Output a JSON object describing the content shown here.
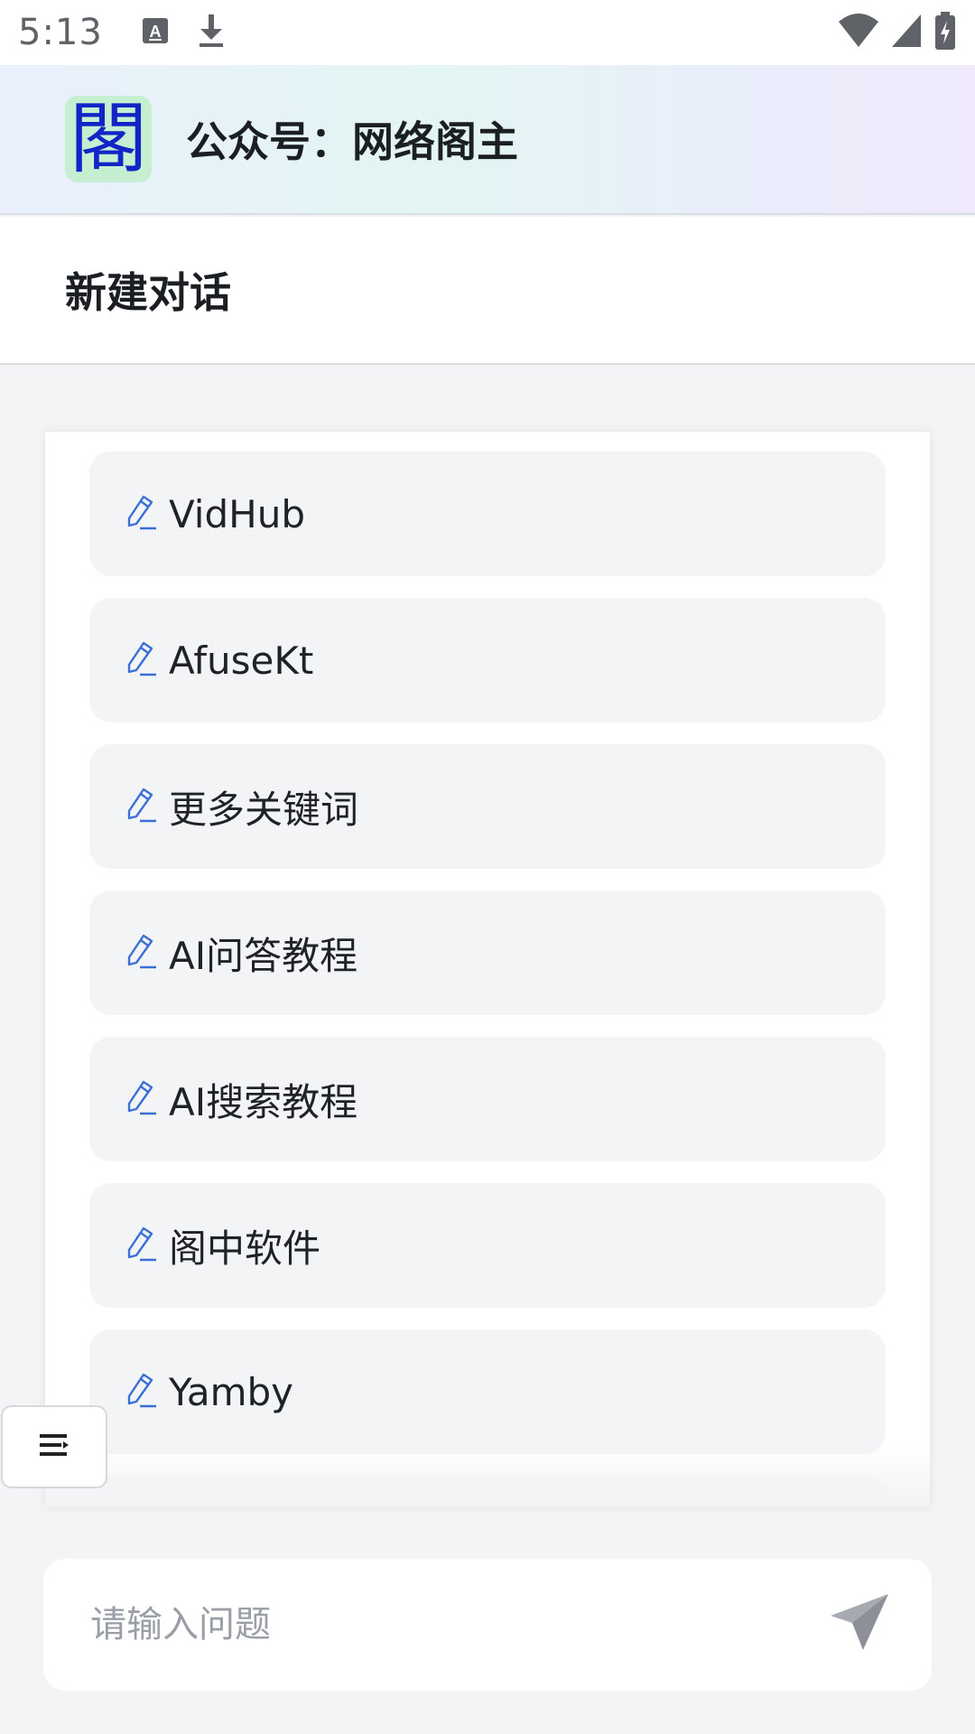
{
  "status_bar": {
    "time": "5:13",
    "icons": [
      "font-download-icon",
      "download-icon",
      "wifi-icon",
      "signal-icon",
      "battery-charging-icon"
    ]
  },
  "header": {
    "logo_char": "閣",
    "title": "公众号：网络阁主"
  },
  "new_chat": {
    "label": "新建对话"
  },
  "suggestions": [
    {
      "label": "VidHub",
      "icon": "pencil-icon"
    },
    {
      "label": "AfuseKt",
      "icon": "pencil-icon"
    },
    {
      "label": "更多关键词",
      "icon": "pencil-icon"
    },
    {
      "label": "AI问答教程",
      "icon": "pencil-icon"
    },
    {
      "label": "AI搜索教程",
      "icon": "pencil-icon"
    },
    {
      "label": "阁中软件",
      "icon": "pencil-icon"
    },
    {
      "label": "Yamby",
      "icon": "pencil-icon"
    }
  ],
  "menu_button": {
    "icon": "menu-list-icon"
  },
  "input": {
    "placeholder": "请输入问题",
    "value": ""
  },
  "send": {
    "icon": "send-paper-plane-icon"
  },
  "colors": {
    "accent_blue": "#3b6fd8",
    "chip_bg": "#f3f4f6",
    "logo_bg": "#c6efd2",
    "logo_fg": "#1226c8"
  }
}
